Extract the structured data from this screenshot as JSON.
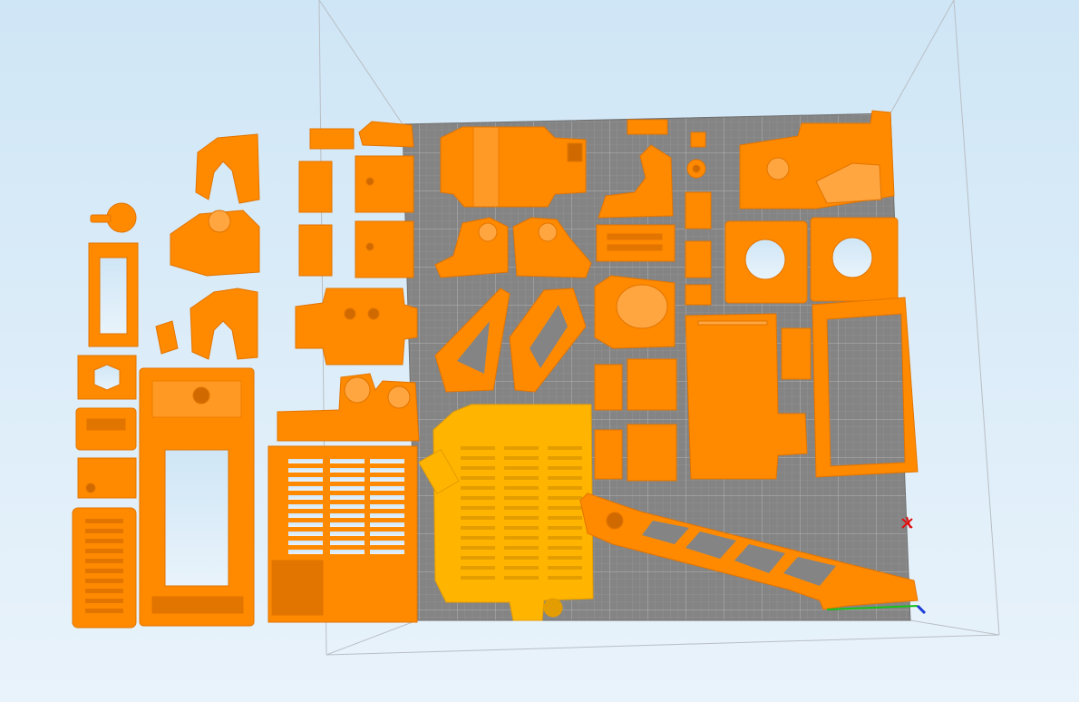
{
  "viewport": {
    "background_top": "#cfe6f6",
    "background_bottom": "#e9f3fb"
  },
  "bed": {
    "color": "#848484",
    "grid_minor": "#9b9b9b",
    "grid_major": "#b4b4b4"
  },
  "build_volume": {
    "edge_color": "#b9bec4"
  },
  "parts": {
    "color": "#ff8a00",
    "shade": "#e27400",
    "highlight": "#ffa640",
    "selected_color": "#ffb400",
    "selected_shade": "#e49d00",
    "hole_color": "#d06a00"
  },
  "axes": {
    "x_color": "#e01010",
    "y_color": "#18c018",
    "z_color": "#1a3cd8"
  },
  "selection": {
    "selected_part": "electronics-box-cover"
  }
}
